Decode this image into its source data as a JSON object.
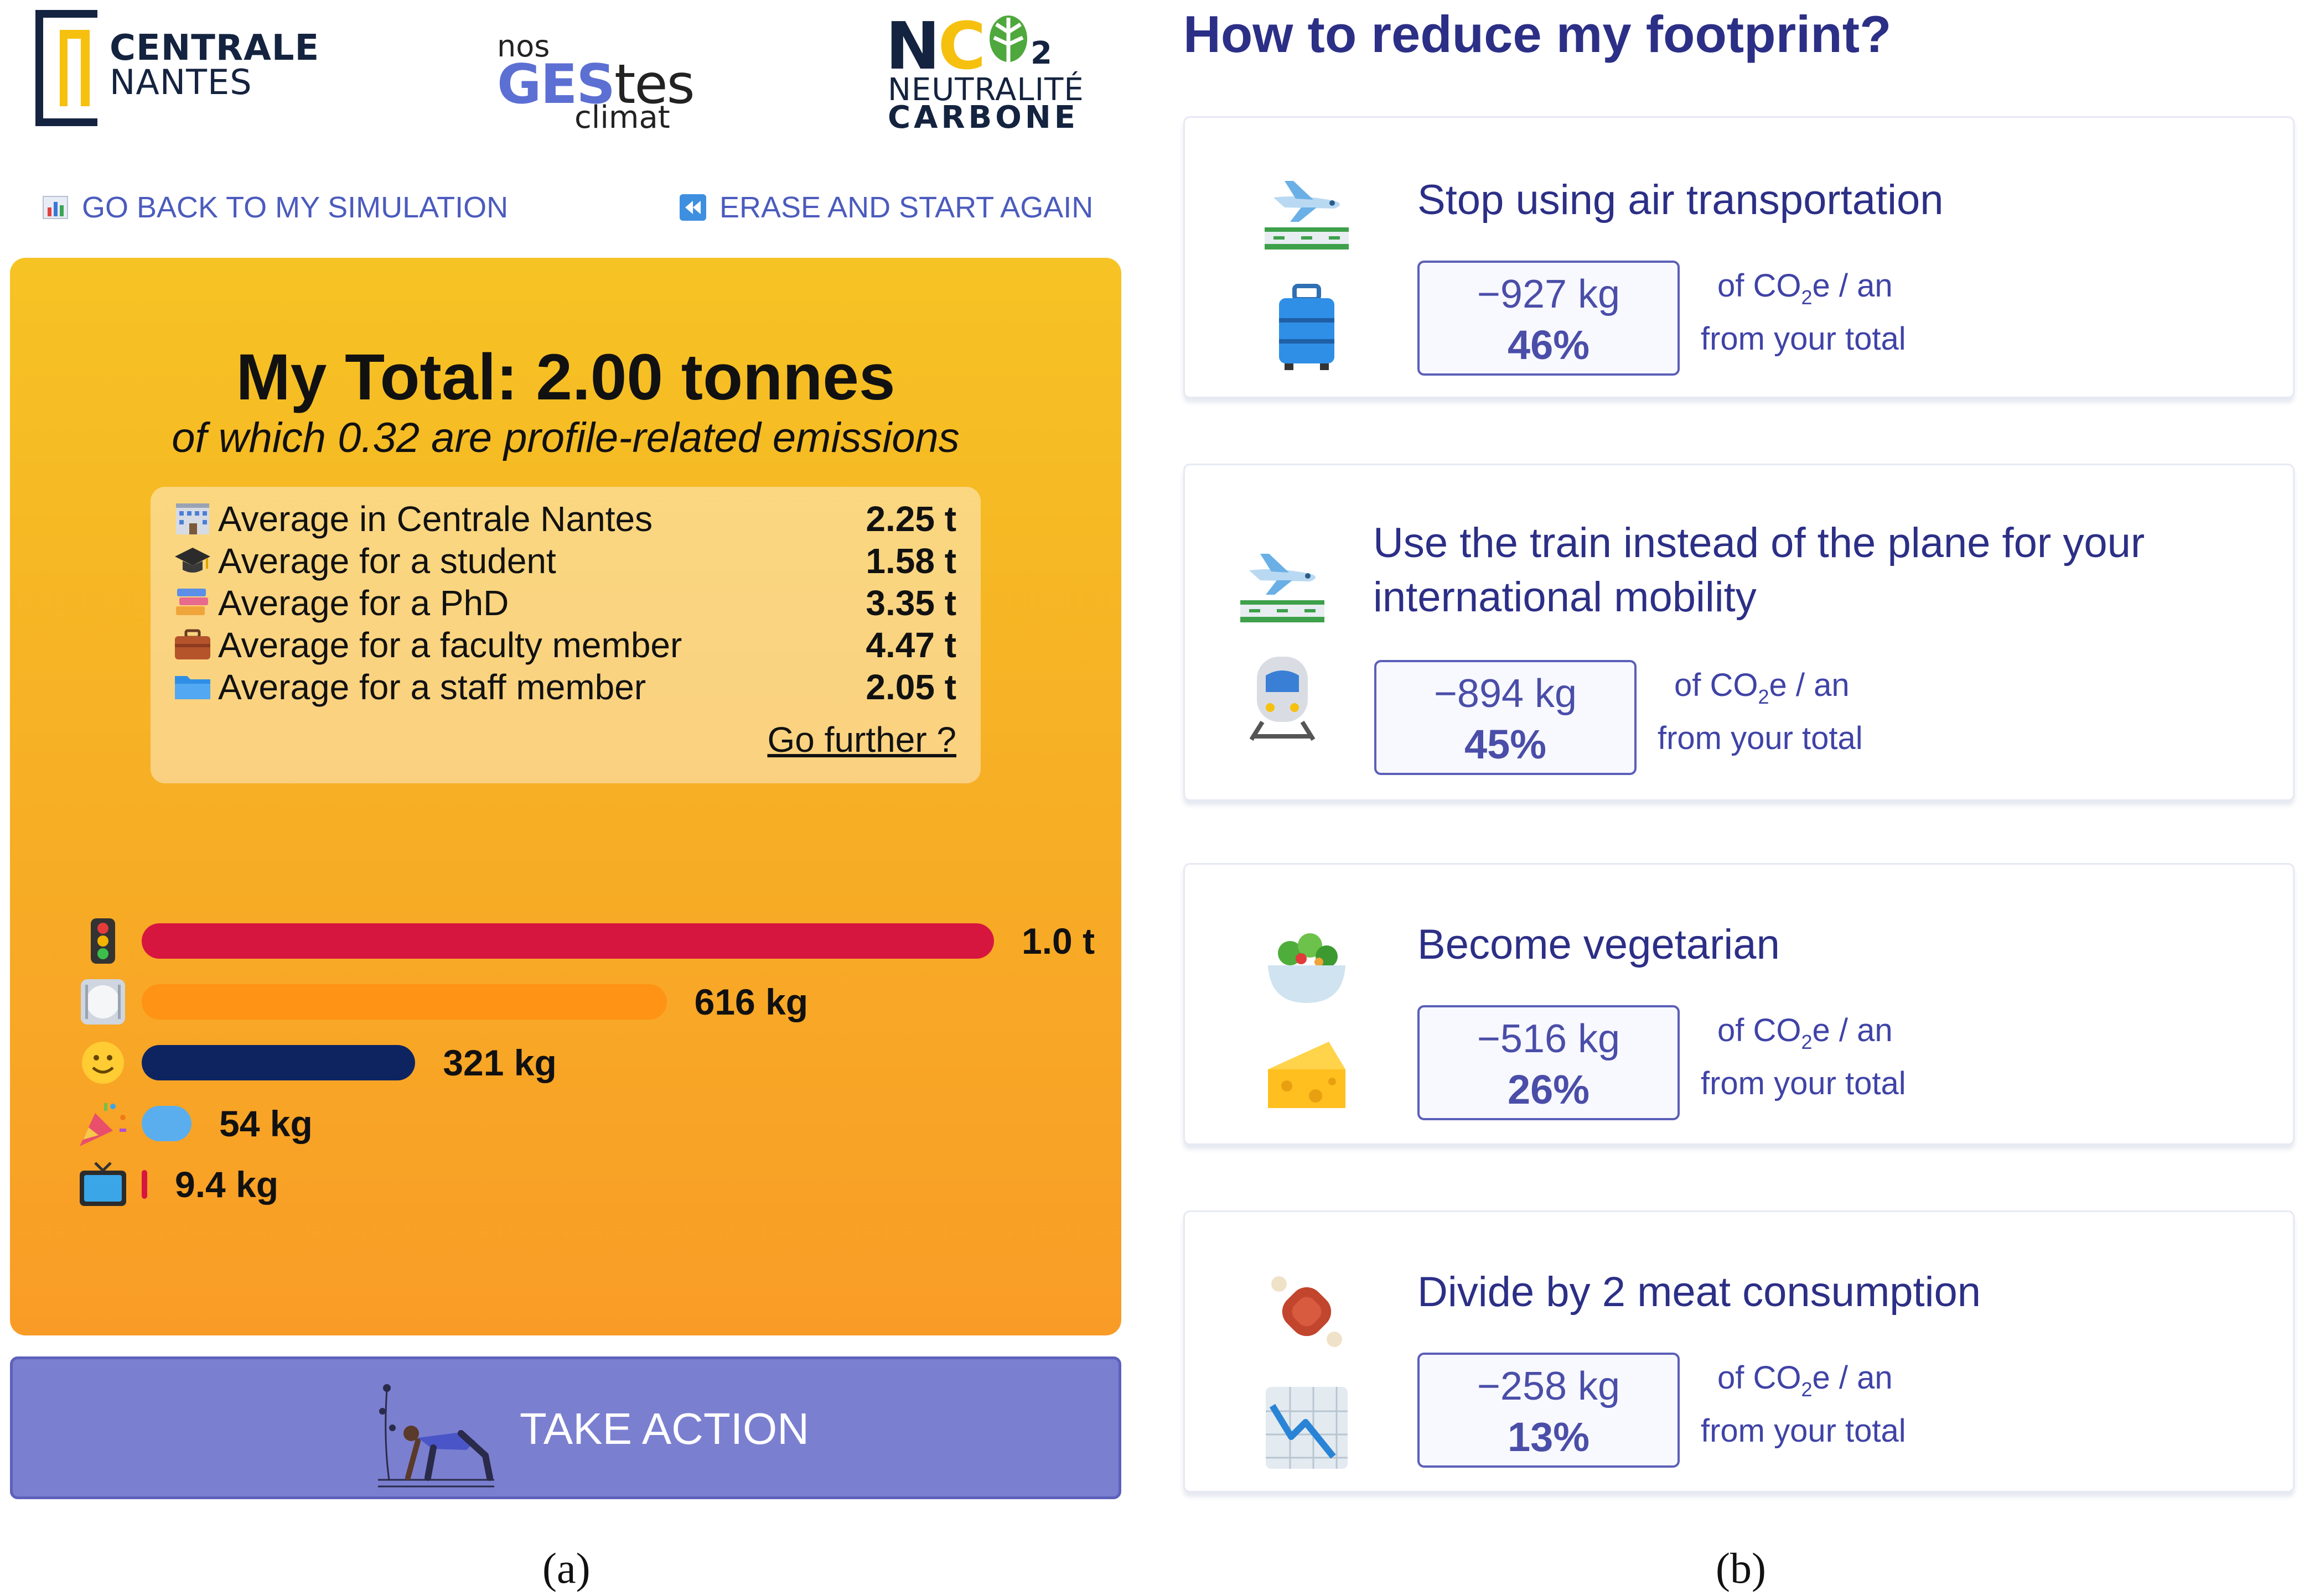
{
  "left_panel": {
    "logos": {
      "centrale": {
        "line1": "CENTRALE",
        "line2": "NANTES"
      },
      "nosgestes": {
        "nos": "nos",
        "ges": "GES",
        "tes": "tes",
        "climat": "climat"
      },
      "nc2": {
        "n": "N",
        "c": "C",
        "two": "2",
        "line2": "NEUTRALITÉ",
        "line3": "CARBONE"
      }
    },
    "nav": {
      "back_label": "GO BACK TO MY SIMULATION",
      "erase_label": "ERASE AND START AGAIN"
    },
    "total": {
      "title": "My Total: 2.00 tonnes",
      "subtitle": "of which 0.32 are profile-related emissions"
    },
    "averages": [
      {
        "icon": "school-building-icon",
        "label": "Average in Centrale Nantes",
        "value": "2.25 t"
      },
      {
        "icon": "graduation-cap-icon",
        "label": "Average for a student",
        "value": "1.58 t"
      },
      {
        "icon": "books-icon",
        "label": "Average for a PhD",
        "value": "3.35 t"
      },
      {
        "icon": "briefcase-icon",
        "label": "Average for a faculty member",
        "value": "4.47 t"
      },
      {
        "icon": "folder-icon",
        "label": "Average for a staff member",
        "value": "2.05 t"
      }
    ],
    "go_further": "Go further ?",
    "bars": [
      {
        "icon": "traffic-light-icon",
        "label": "1.0 t",
        "value_kg": 1000,
        "color": "#d7163f"
      },
      {
        "icon": "plate-icon",
        "label": "616 kg",
        "value_kg": 616,
        "color": "#ff9316"
      },
      {
        "icon": "smiley-icon",
        "label": "321 kg",
        "value_kg": 321,
        "color": "#0e2461"
      },
      {
        "icon": "party-popper-icon",
        "label": "54 kg",
        "value_kg": 54,
        "color": "#5aaeee"
      },
      {
        "icon": "television-icon",
        "label": "9.4 kg",
        "value_kg": 9.4,
        "color": "#d7163f"
      }
    ],
    "take_action": "TAKE ACTION",
    "caption": "(a)"
  },
  "right_panel": {
    "title": "How to reduce my footprint?",
    "actions": [
      {
        "title_lines": [
          "Stop using air transportation"
        ],
        "kg": "−927 kg",
        "pct": "46%",
        "icon_top": "airplane-icon",
        "icon_bottom": "suitcase-icon"
      },
      {
        "title_lines": [
          "Use the train instead of the plane for your",
          "international mobility"
        ],
        "kg": "−894 kg",
        "pct": "45%",
        "icon_top": "airplane-icon",
        "icon_bottom": "train-icon"
      },
      {
        "title_lines": [
          "Become vegetarian"
        ],
        "kg": "−516 kg",
        "pct": "26%",
        "icon_top": "salad-icon",
        "icon_bottom": "cheese-icon"
      },
      {
        "title_lines": [
          "Divide by 2 meat consumption"
        ],
        "kg": "−258 kg",
        "pct": "13%",
        "icon_top": "meat-icon",
        "icon_bottom": "chart-decreasing-icon"
      }
    ],
    "impact_text": {
      "prefix": "of CO",
      "sub": "2",
      "suffix": "e / an",
      "line2": "from your total"
    },
    "caption": "(b)"
  },
  "colors": {
    "accent": "#4b5bbd",
    "title_navy": "#2c2f86",
    "card_yellow": "#f6c324",
    "card_orange": "#f99c27",
    "button_purple": "#7b7fd0"
  }
}
